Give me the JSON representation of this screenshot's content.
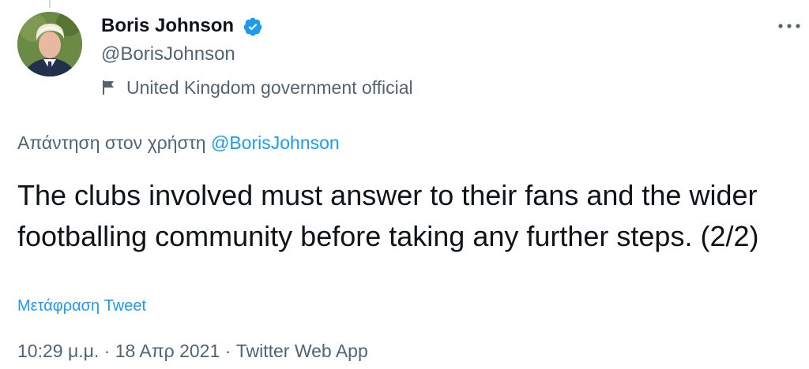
{
  "tweet": {
    "author": {
      "display_name": "Boris Johnson",
      "handle": "@BorisJohnson",
      "label": "United Kingdom government official",
      "avatar": "profile-photo"
    },
    "reply_to": {
      "prefix": "Απάντηση στον χρήστη",
      "mention": "@BorisJohnson"
    },
    "text": "The clubs involved must answer to their fans and the wider footballing community before taking any further steps. (2/2)",
    "translate_label": "Μετάφραση Tweet",
    "timestamp": {
      "time": "10:29 μ.μ.",
      "date": "18 Απρ 2021",
      "source": "Twitter Web App",
      "separator": "·"
    }
  },
  "icons": {
    "verified": "verified-badge-icon",
    "government": "flag-icon",
    "more": "more-options-icon"
  },
  "colors": {
    "accent": "#1d9bf0",
    "secondary_text": "#536471",
    "primary_text": "#0f1419"
  }
}
